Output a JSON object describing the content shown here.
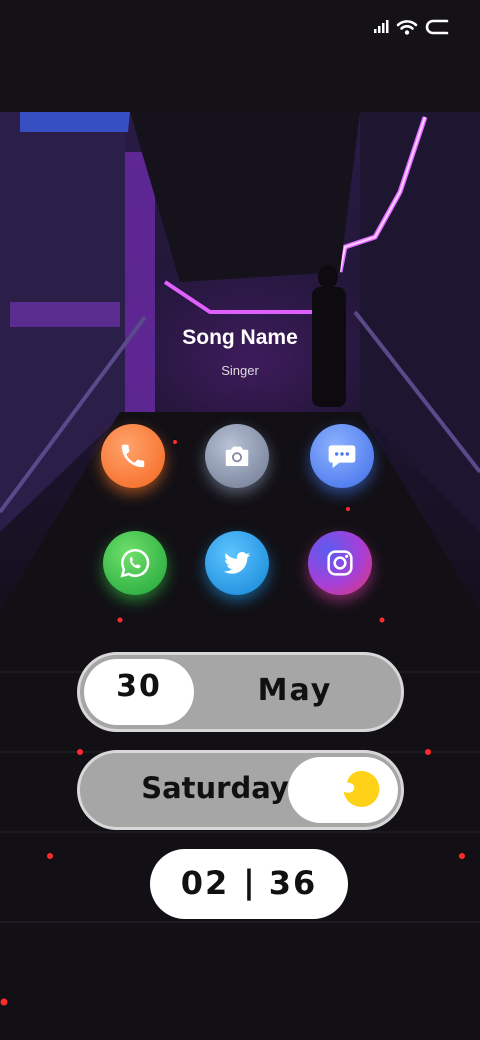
{
  "status_bar": {
    "icons": [
      "signal-icon",
      "wifi-icon",
      "battery-icon"
    ]
  },
  "music": {
    "song_name": "Song Name",
    "singer": "Singer"
  },
  "apps": [
    {
      "name": "phone",
      "icon": "phone-icon",
      "color": "#ff7a2e"
    },
    {
      "name": "camera",
      "icon": "camera-icon",
      "color": "#8c97b0"
    },
    {
      "name": "messages",
      "icon": "message-icon",
      "color": "#4d7cf0"
    },
    {
      "name": "whatsapp",
      "icon": "whatsapp-icon",
      "color": "#2fbf3f"
    },
    {
      "name": "twitter",
      "icon": "twitter-icon",
      "color": "#1f9be8"
    },
    {
      "name": "instagram",
      "icon": "instagram-icon",
      "color": "#b23ad0"
    }
  ],
  "date_widget": {
    "day": "30",
    "month": "May"
  },
  "weekday_widget": {
    "weekday": "Saturday",
    "icon": "moon-icon",
    "icon_color": "#ffd21a"
  },
  "clock": {
    "hour": "02",
    "minute": "36",
    "separator": "|"
  }
}
